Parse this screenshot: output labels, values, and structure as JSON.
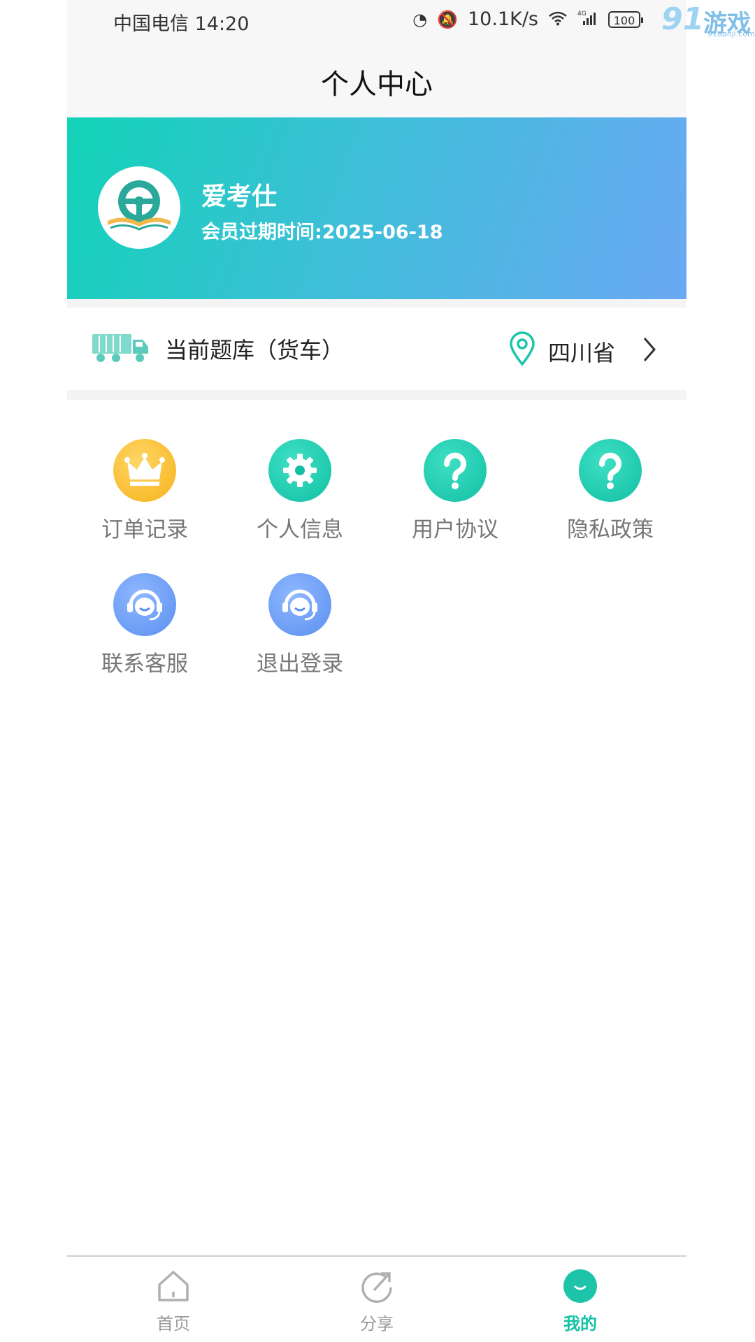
{
  "status_bar": {
    "carrier_time": "中国电信 14:20",
    "network_speed": "10.1K/s",
    "network_type": "4G",
    "battery": "100"
  },
  "watermark": {
    "big": "91",
    "text": "游戏",
    "sub": "91danji.com"
  },
  "header": {
    "title": "个人中心"
  },
  "profile": {
    "name": "爱考仕",
    "expiry": "会员过期时间:2025-06-18"
  },
  "bank": {
    "label": "当前题库（货车）",
    "province": "四川省"
  },
  "menu": [
    {
      "label": "订单记录",
      "icon": "crown-icon",
      "color": "#f6b21a"
    },
    {
      "label": "个人信息",
      "icon": "gear-icon",
      "color": "#12bfa4"
    },
    {
      "label": "用户协议",
      "icon": "question-icon",
      "color": "#12bfa4"
    },
    {
      "label": "隐私政策",
      "icon": "question-icon",
      "color": "#12bfa4"
    },
    {
      "label": "联系客服",
      "icon": "headset-icon",
      "color": "#5a8ff0"
    },
    {
      "label": "退出登录",
      "icon": "headset-icon",
      "color": "#5a8ff0"
    }
  ],
  "nav": [
    {
      "label": "首页",
      "icon": "home-icon",
      "active": false
    },
    {
      "label": "分享",
      "icon": "share-icon",
      "active": false
    },
    {
      "label": "我的",
      "icon": "profile-icon",
      "active": true
    }
  ],
  "colors": {
    "accent": "#14c2a6",
    "banner_start": "#11d3b6",
    "banner_end": "#6aa8f4"
  }
}
